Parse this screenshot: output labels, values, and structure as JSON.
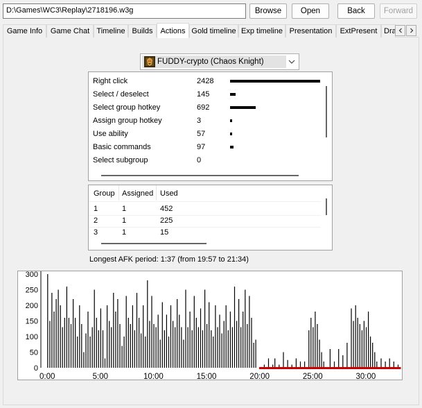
{
  "toolbar": {
    "path": "D:\\Games\\WC3\\Replay\\2718196.w3g",
    "browse_label": "Browse",
    "open_label": "Open",
    "back_label": "Back",
    "forward_label": "Forward"
  },
  "tabs": [
    {
      "label": "Game Info",
      "active": false
    },
    {
      "label": "Game Chat",
      "active": false
    },
    {
      "label": "Timeline",
      "active": false
    },
    {
      "label": "Builds",
      "active": false
    },
    {
      "label": "Actions",
      "active": true
    },
    {
      "label": "Gold timeline",
      "active": false
    },
    {
      "label": "Exp timeline",
      "active": false
    },
    {
      "label": "Presentation",
      "active": false
    },
    {
      "label": "ExtPresent",
      "active": false
    },
    {
      "label": "Dra",
      "active": false
    }
  ],
  "player": {
    "selected": "FUDDY-crypto (Chaos Knight)",
    "icon": "chaos-knight-hero-icon"
  },
  "actions": [
    {
      "name": "Right click",
      "value": 2428
    },
    {
      "name": "Select / deselect",
      "value": 145
    },
    {
      "name": "Select group hotkey",
      "value": 692
    },
    {
      "name": "Assign group hotkey",
      "value": 3
    },
    {
      "name": "Use ability",
      "value": 57
    },
    {
      "name": "Basic commands",
      "value": 97
    },
    {
      "name": "Select subgroup",
      "value": 0
    }
  ],
  "groups": {
    "headers": [
      "Group",
      "Assigned",
      "Used"
    ],
    "rows": [
      [
        "1",
        "1",
        "452"
      ],
      [
        "2",
        "1",
        "225"
      ],
      [
        "3",
        "1",
        "15"
      ]
    ]
  },
  "afk_text": "Longest AFK period: 1:37 (from 19:57 to 21:34)",
  "chart_data": {
    "type": "bar",
    "x_tick_labels": [
      "0:00",
      "5:00",
      "10:00",
      "15:00",
      "20:00",
      "25:00",
      "30:00"
    ],
    "y_tick_labels": [
      "0",
      "50",
      "100",
      "150",
      "200",
      "250",
      "300"
    ],
    "ylim": [
      0,
      300
    ],
    "xlim_minutes": [
      -0.6,
      33.4
    ],
    "bar_color": "#000000",
    "afk_color": "#cc0000",
    "afk_marker_minutes": [
      19.95,
      33.3
    ],
    "series_minutes_values": [
      [
        0.0,
        300
      ],
      [
        0.2,
        150
      ],
      [
        0.4,
        240
      ],
      [
        0.6,
        180
      ],
      [
        0.8,
        220
      ],
      [
        1.0,
        250
      ],
      [
        1.2,
        200
      ],
      [
        1.4,
        130
      ],
      [
        1.6,
        160
      ],
      [
        1.8,
        260
      ],
      [
        2.0,
        160
      ],
      [
        2.2,
        140
      ],
      [
        2.4,
        220
      ],
      [
        2.6,
        160
      ],
      [
        2.8,
        100
      ],
      [
        3.0,
        200
      ],
      [
        3.2,
        140
      ],
      [
        3.4,
        50
      ],
      [
        3.6,
        110
      ],
      [
        3.8,
        180
      ],
      [
        4.0,
        100
      ],
      [
        4.2,
        130
      ],
      [
        4.4,
        250
      ],
      [
        4.6,
        160
      ],
      [
        4.8,
        120
      ],
      [
        5.0,
        190
      ],
      [
        5.2,
        120
      ],
      [
        5.4,
        30
      ],
      [
        5.6,
        200
      ],
      [
        5.8,
        150
      ],
      [
        6.0,
        130
      ],
      [
        6.2,
        240
      ],
      [
        6.4,
        180
      ],
      [
        6.6,
        220
      ],
      [
        6.8,
        140
      ],
      [
        7.0,
        70
      ],
      [
        7.2,
        100
      ],
      [
        7.4,
        230
      ],
      [
        7.6,
        160
      ],
      [
        7.8,
        140
      ],
      [
        8.0,
        200
      ],
      [
        8.2,
        120
      ],
      [
        8.4,
        240
      ],
      [
        8.6,
        160
      ],
      [
        8.8,
        110
      ],
      [
        9.0,
        200
      ],
      [
        9.2,
        100
      ],
      [
        9.4,
        280
      ],
      [
        9.6,
        150
      ],
      [
        9.8,
        230
      ],
      [
        10.0,
        140
      ],
      [
        10.2,
        130
      ],
      [
        10.4,
        170
      ],
      [
        10.6,
        90
      ],
      [
        10.8,
        210
      ],
      [
        11.0,
        120
      ],
      [
        11.2,
        170
      ],
      [
        11.4,
        100
      ],
      [
        11.6,
        200
      ],
      [
        11.8,
        150
      ],
      [
        12.0,
        130
      ],
      [
        12.2,
        220
      ],
      [
        12.4,
        170
      ],
      [
        12.6,
        130
      ],
      [
        12.8,
        90
      ],
      [
        13.0,
        250
      ],
      [
        13.2,
        130
      ],
      [
        13.4,
        180
      ],
      [
        13.6,
        120
      ],
      [
        13.8,
        230
      ],
      [
        14.0,
        160
      ],
      [
        14.2,
        130
      ],
      [
        14.4,
        190
      ],
      [
        14.6,
        120
      ],
      [
        14.8,
        250
      ],
      [
        15.0,
        140
      ],
      [
        15.2,
        210
      ],
      [
        15.4,
        120
      ],
      [
        15.6,
        100
      ],
      [
        15.8,
        200
      ],
      [
        16.0,
        130
      ],
      [
        16.2,
        170
      ],
      [
        16.4,
        110
      ],
      [
        16.6,
        150
      ],
      [
        16.8,
        200
      ],
      [
        17.0,
        120
      ],
      [
        17.2,
        180
      ],
      [
        17.4,
        130
      ],
      [
        17.6,
        260
      ],
      [
        17.8,
        150
      ],
      [
        18.0,
        220
      ],
      [
        18.2,
        130
      ],
      [
        18.4,
        180
      ],
      [
        18.6,
        250
      ],
      [
        18.8,
        140
      ],
      [
        19.0,
        230
      ],
      [
        19.2,
        160
      ],
      [
        19.4,
        80
      ],
      [
        19.6,
        90
      ],
      [
        20.4,
        10
      ],
      [
        20.8,
        30
      ],
      [
        21.2,
        10
      ],
      [
        21.4,
        30
      ],
      [
        21.8,
        10
      ],
      [
        22.2,
        50
      ],
      [
        22.6,
        25
      ],
      [
        23.0,
        10
      ],
      [
        23.4,
        30
      ],
      [
        23.8,
        20
      ],
      [
        24.2,
        20
      ],
      [
        24.6,
        120
      ],
      [
        24.8,
        160
      ],
      [
        25.0,
        130
      ],
      [
        25.2,
        180
      ],
      [
        25.4,
        140
      ],
      [
        25.6,
        90
      ],
      [
        25.8,
        50
      ],
      [
        26.0,
        20
      ],
      [
        26.6,
        60
      ],
      [
        27.0,
        20
      ],
      [
        27.4,
        60
      ],
      [
        27.8,
        40
      ],
      [
        28.2,
        80
      ],
      [
        28.6,
        190
      ],
      [
        28.8,
        150
      ],
      [
        29.0,
        200
      ],
      [
        29.2,
        160
      ],
      [
        29.4,
        140
      ],
      [
        29.6,
        120
      ],
      [
        29.8,
        150
      ],
      [
        30.0,
        130
      ],
      [
        30.2,
        180
      ],
      [
        30.4,
        100
      ],
      [
        30.6,
        80
      ],
      [
        30.8,
        50
      ],
      [
        31.0,
        20
      ],
      [
        31.4,
        30
      ],
      [
        31.8,
        20
      ],
      [
        32.2,
        30
      ],
      [
        32.6,
        20
      ],
      [
        33.0,
        10
      ]
    ]
  }
}
